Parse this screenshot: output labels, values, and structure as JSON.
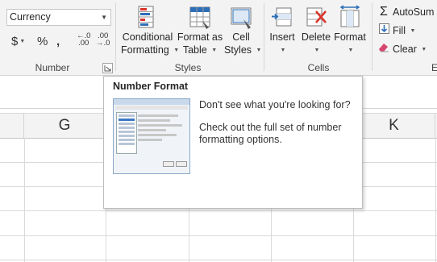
{
  "ribbon": {
    "number": {
      "format_value": "Currency",
      "currency_symbol": "$",
      "percent_symbol": "%",
      "comma_symbol": ",",
      "increase_decimal_top": "←.0",
      "increase_decimal_bottom": ".00",
      "decrease_decimal_top": ".00",
      "decrease_decimal_bottom": "→.0",
      "group_label": "Number"
    },
    "styles": {
      "conditional_formatting_line1": "Conditional",
      "conditional_formatting_line2": "Formatting",
      "format_as_table_line1": "Format as",
      "format_as_table_line2": "Table",
      "cell_styles_line1": "Cell",
      "cell_styles_line2": "Styles",
      "group_label": "Styles"
    },
    "cells": {
      "insert_label": "Insert",
      "delete_label": "Delete",
      "format_label": "Format",
      "group_label": "Cells"
    },
    "editing": {
      "autosum_label": "AutoSum",
      "fill_label": "Fill",
      "clear_label": "Clear",
      "group_label_partial": "E"
    }
  },
  "grid": {
    "columns": [
      "G",
      "K"
    ]
  },
  "tooltip": {
    "title": "Number Format",
    "line1": "Don't see what you're looking for?",
    "line2": "Check out the full set of number formatting options."
  },
  "colors": {
    "ribbon_bg": "#f3f3f3",
    "delete_x": "#d9342b",
    "accent_blue": "#2e6fb7",
    "clear_pink": "#d6476f"
  },
  "icons": [
    "dropdown-chevron-icon",
    "dialog-launcher-icon",
    "conditional-formatting-icon",
    "format-as-table-icon",
    "cell-styles-icon",
    "insert-cells-icon",
    "delete-cells-icon",
    "format-cells-icon",
    "autosum-icon",
    "fill-icon",
    "clear-icon"
  ]
}
